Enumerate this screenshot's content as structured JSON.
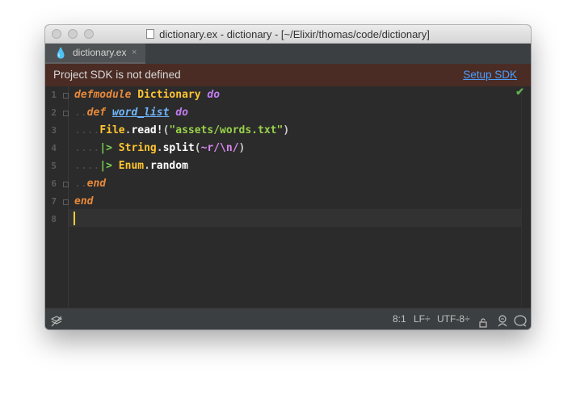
{
  "window": {
    "title": "dictionary.ex - dictionary - [~/Elixir/thomas/code/dictionary]"
  },
  "tab": {
    "label": "dictionary.ex",
    "close": "×"
  },
  "notice": {
    "message": "Project SDK is not defined",
    "action": "Setup SDK"
  },
  "editor": {
    "line_numbers": [
      "1",
      "2",
      "3",
      "4",
      "5",
      "6",
      "7",
      "8"
    ],
    "lines": [
      [
        "defmodule",
        " ",
        "Dictionary",
        " ",
        "do"
      ],
      [
        "def",
        " ",
        "word_list",
        " ",
        "do"
      ],
      [
        "File",
        ".",
        "read!",
        "(",
        "\"assets/words.txt\"",
        ")"
      ],
      [
        "|>",
        " ",
        "String",
        ".",
        "split",
        "(",
        "~r/\\n/",
        ")"
      ],
      [
        "|>",
        " ",
        "Enum",
        ".",
        "random"
      ],
      [
        "end"
      ],
      [
        "end"
      ]
    ]
  },
  "status": {
    "position": "8:1",
    "line_ending": "LF÷",
    "encoding": "UTF-8÷"
  },
  "colors": {
    "accent_link": "#4c9dfd",
    "notice_bg": "#4a2c25",
    "keyword": "#c27ef3",
    "module": "#ffc531",
    "function": "#6fb7ff",
    "string": "#98d14b",
    "caret": "#f8cc36"
  }
}
